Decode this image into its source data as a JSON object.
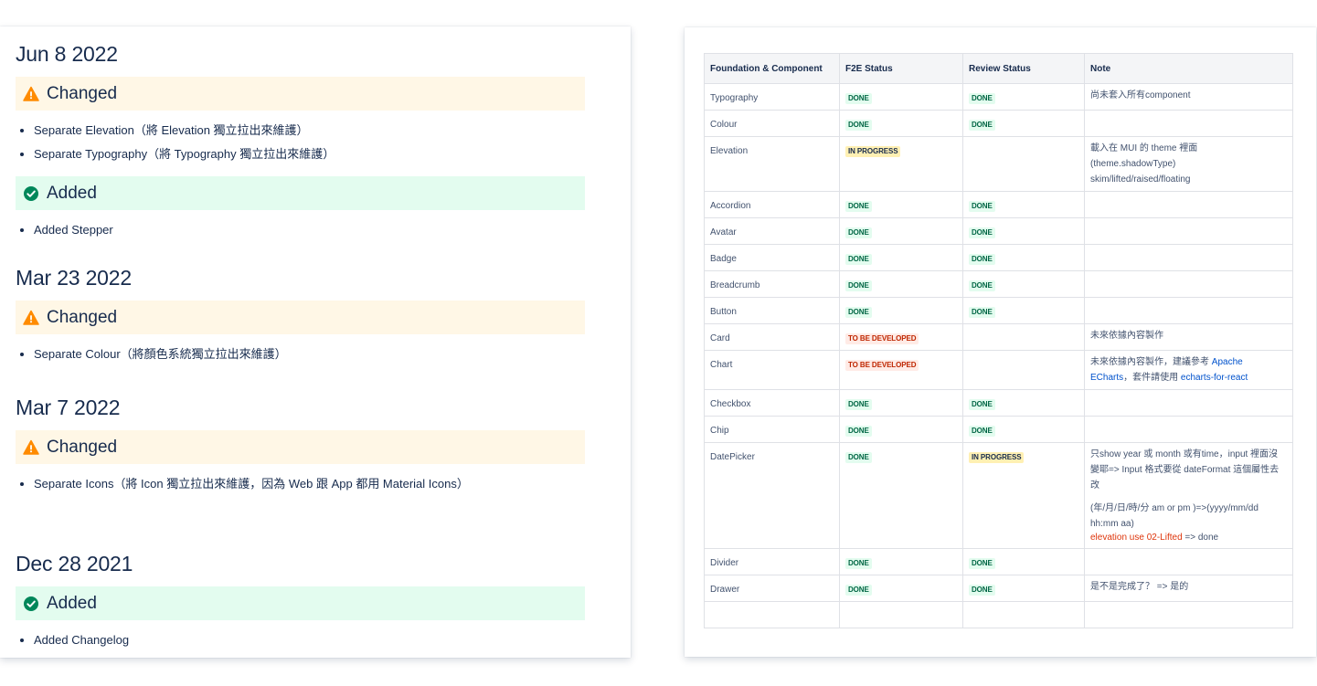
{
  "changelog": [
    {
      "date": "Jun 8 2022",
      "sections": [
        {
          "kind": "changed",
          "heading": "Changed",
          "items": [
            "Separate Elevation（將 Elevation 獨立拉出來維護）",
            "Separate Typography（將 Typography 獨立拉出來維護）"
          ]
        },
        {
          "kind": "added",
          "heading": "Added",
          "items": [
            "Added Stepper"
          ]
        }
      ]
    },
    {
      "date": "Mar 23 2022",
      "sections": [
        {
          "kind": "changed",
          "heading": "Changed",
          "items": [
            "Separate Colour（將顏色系統獨立拉出來維護）"
          ]
        }
      ]
    },
    {
      "date": "Mar 7 2022",
      "sections": [
        {
          "kind": "changed",
          "heading": "Changed",
          "items": [
            "Separate Icons（將 Icon 獨立拉出來維護，因為 Web 跟 App 都用 Material Icons）"
          ]
        }
      ]
    },
    {
      "date": "Dec 28 2021",
      "sections": [
        {
          "kind": "added",
          "heading": "Added",
          "items": [
            "Added Changelog"
          ]
        }
      ]
    }
  ],
  "table": {
    "headers": [
      "Foundation & Component",
      "F2E Status",
      "Review Status",
      "Note"
    ],
    "rows": [
      {
        "name": "Typography",
        "f2e": "DONE",
        "review": "DONE",
        "note": [
          "尚未套入所有component"
        ]
      },
      {
        "name": "Colour",
        "f2e": "DONE",
        "review": "DONE",
        "note": []
      },
      {
        "name": "Elevation",
        "f2e": "IN PROGRESS",
        "review": "",
        "note": [
          "載入在 MUI 的 theme 裡面",
          "(theme.shadowType)",
          "skim/lifted/raised/floating"
        ]
      },
      {
        "name": "Accordion",
        "f2e": "DONE",
        "review": "DONE",
        "note": []
      },
      {
        "name": "Avatar",
        "f2e": "DONE",
        "review": "DONE",
        "note": []
      },
      {
        "name": "Badge",
        "f2e": "DONE",
        "review": "DONE",
        "note": []
      },
      {
        "name": "Breadcrumb",
        "f2e": "DONE",
        "review": "DONE",
        "note": []
      },
      {
        "name": "Button",
        "f2e": "DONE",
        "review": "DONE",
        "note": []
      },
      {
        "name": "Card",
        "f2e": "TO BE DEVELOPED",
        "review": "",
        "note": [
          "未來依據內容製作"
        ]
      },
      {
        "name": "Chart",
        "f2e": "TO BE DEVELOPED",
        "review": "",
        "note_rich": "chart"
      },
      {
        "name": "Checkbox",
        "f2e": "DONE",
        "review": "DONE",
        "note": []
      },
      {
        "name": "Chip",
        "f2e": "DONE",
        "review": "DONE",
        "note": []
      },
      {
        "name": "DatePicker",
        "f2e": "DONE",
        "review": "IN PROGRESS",
        "note_rich": "datepicker"
      },
      {
        "name": "Divider",
        "f2e": "DONE",
        "review": "DONE",
        "note": []
      },
      {
        "name": "Drawer",
        "f2e": "DONE",
        "review": "DONE",
        "note": [
          "是不是完成了？ => 是的"
        ]
      }
    ],
    "chart_note": {
      "prefix": "未來依據內容製作，建議參考 ",
      "link1": "Apache ECharts",
      "middle": "，套件請使用 ",
      "link2": "echarts-for-react"
    },
    "datepicker_note": {
      "line1": "只show year 或 month 或有time，input 裡面沒變耶=> Input 格式要從 dateFormat 這個屬性去改",
      "line2": "(年/月/日/時/分 am or pm )=>(yyyy/mm/dd hh:mm aa)",
      "red": "elevation use 02-Lifted",
      "tail": " => done"
    }
  },
  "colors": {
    "changed_bg": "#fff7e6",
    "added_bg": "#e3fcef",
    "warn_icon": "#ff8b00",
    "ok_icon": "#00875a",
    "done_bg": "#e3fcef",
    "done_fg": "#006644",
    "progress_bg": "#fff0b3",
    "todo_bg": "#ffebe6",
    "todo_fg": "#bf2600",
    "link": "#0052cc"
  }
}
